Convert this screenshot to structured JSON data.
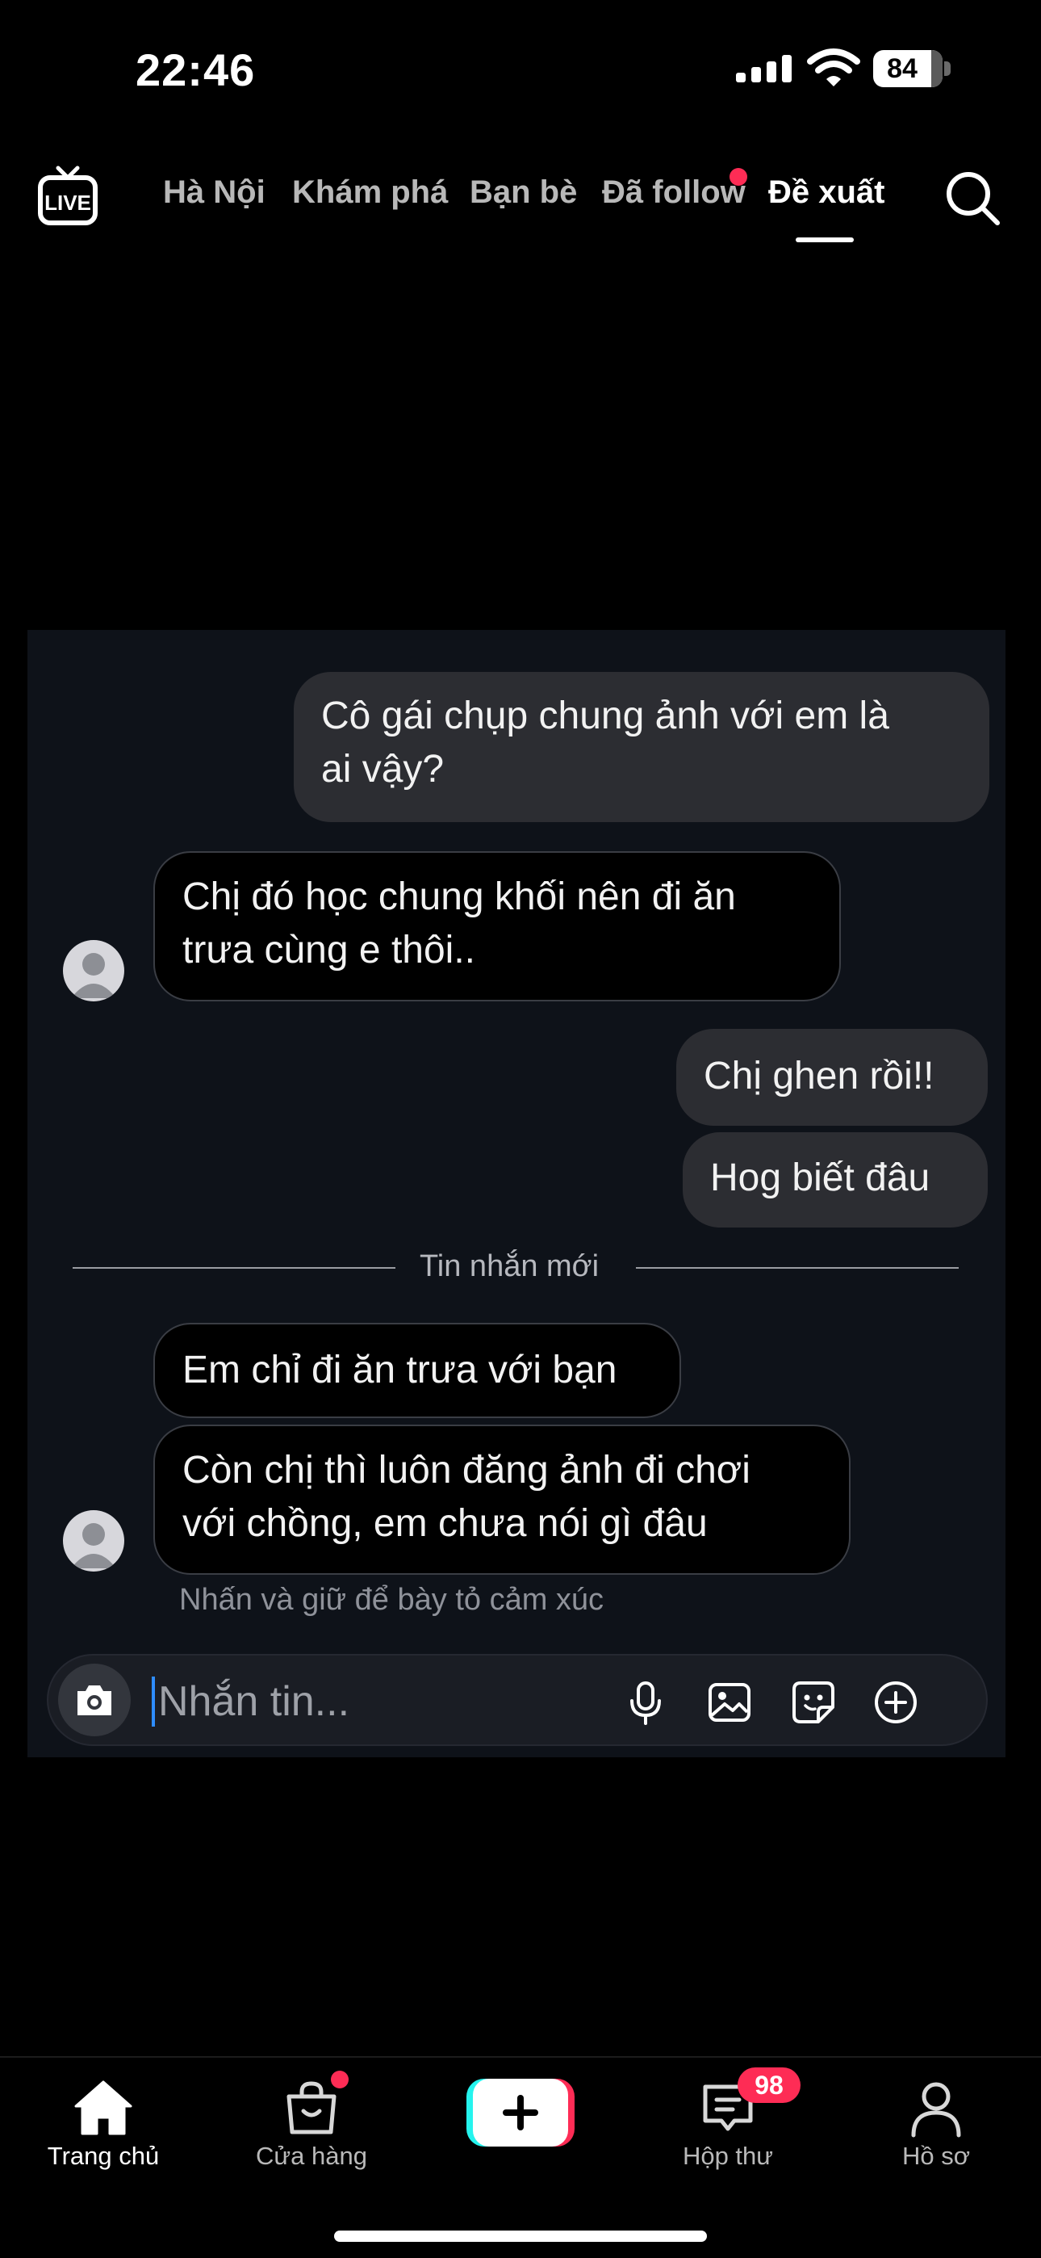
{
  "status_bar": {
    "time": "22:46",
    "battery": "84"
  },
  "top_nav": {
    "live_icon": "live-icon",
    "tabs": [
      {
        "label": "Hà Nội"
      },
      {
        "label": "Khám phá"
      },
      {
        "label": "Bạn bè"
      },
      {
        "label": "Đã follow",
        "has_dot": true
      },
      {
        "label": "Đề xuất",
        "active": true
      }
    ],
    "search_icon": "search-icon"
  },
  "chat": {
    "messages": [
      {
        "direction": "outgoing",
        "lines": [
          "Cô gái chụp chung ảnh với em là",
          "ai vậy?"
        ]
      },
      {
        "direction": "incoming",
        "lines": [
          "Chị đó học chung khối nên đi ăn",
          "trưa cùng e thôi.."
        ]
      },
      {
        "direction": "outgoing",
        "lines": [
          "Chị ghen rồi!!"
        ]
      },
      {
        "direction": "outgoing",
        "lines": [
          "Hog biết đâu"
        ]
      },
      {
        "direction": "incoming",
        "lines": [
          "Em chỉ đi ăn trưa với bạn"
        ]
      },
      {
        "direction": "incoming",
        "lines": [
          "Còn chị thì luôn đăng ảnh đi chơi",
          "với chồng, em chưa nói gì đâu"
        ]
      }
    ],
    "divider_label": "Tin nhắn mới",
    "reaction_hint": "Nhấn và giữ để bày tỏ cảm xúc",
    "composer": {
      "placeholder": "Nhắn tin...",
      "icons": [
        "camera-icon",
        "microphone-icon",
        "image-icon",
        "sticker-icon",
        "plus-circle-icon"
      ]
    }
  },
  "bottom_nav": {
    "items": [
      {
        "label": "Trang chủ",
        "icon": "home-icon",
        "active": true
      },
      {
        "label": "Cửa hàng",
        "icon": "shop-bag-icon",
        "has_dot": true
      },
      {
        "label": "",
        "icon": "create-plus-icon"
      },
      {
        "label": "Hộp thư",
        "icon": "inbox-icon",
        "badge": "98"
      },
      {
        "label": "Hồ sơ",
        "icon": "profile-icon"
      }
    ]
  },
  "colors": {
    "accent": "#fe2c55",
    "chat_background": "#0e1219",
    "outgoing_bubble": "#2c2d32",
    "caret": "#2e8cff"
  }
}
